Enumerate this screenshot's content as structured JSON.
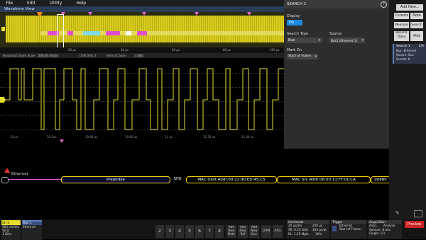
{
  "menu": {
    "file": "File",
    "edit": "Edit",
    "utility": "Utility",
    "help": "Help"
  },
  "waveform_view": {
    "title": "Waveform View"
  },
  "overview": {
    "time_labels": [
      "20 µs",
      "40 µs",
      "60 µs",
      "80 µs",
      "100 µs"
    ],
    "bus_segments": [
      {
        "color": "#e24ed0"
      },
      {
        "color": "#e24ed0"
      },
      {
        "color": "#7fd9e6"
      },
      {
        "color": "#e24ed0"
      },
      {
        "color": "#ffffff"
      },
      {
        "color": "#e24ed0"
      }
    ]
  },
  "zoom_bar": {
    "horizontal_zoom_label": "Horizontal Zoom Scale",
    "horizontal_zoom_value": "200.00 ns/div",
    "horizontal_pos": "[190.00s] 4",
    "vertical_zoom_label": "Vertical Zoom",
    "vertical_zoom_value": "1.00x"
  },
  "main_time_ticks": [
    "10 µs",
    "10.2µs",
    "10.40 µs",
    "10.60 µs",
    "11 µs",
    "11.20 µs",
    "11.40 µs"
  ],
  "search_panel": {
    "title": "SEARCH 1",
    "display_label": "Display",
    "display_toggle": "On",
    "search_type_label": "Search Type",
    "search_type_value": "Bus",
    "source_label": "Source",
    "source_value": "Bus1 (Ethernet 1)",
    "mark_on_label": "Mark On",
    "mark_on_value": "Start of Frame"
  },
  "sidebar": {
    "add_new": "Add New...",
    "cursors": "Cursors",
    "note": "Note",
    "measure": "Measure",
    "search": "Search",
    "results_table": "Results Table",
    "plot": "Plot",
    "search_badge_title": "Search 1",
    "search_badge_count": "2/4",
    "search_badge_bus": "Bus: Ethernet",
    "search_badge_search": "Search: Bus",
    "search_badge_events": "Events: 6"
  },
  "bus": {
    "name": "Ethernet",
    "preamble": "Preamble",
    "sfd": "SFD",
    "mac_dest": "MAC Dest Addr:00:22:90:ED:45:C5",
    "mac_src": "MAC Src Addr:08:00:11:FF:01:CA",
    "tail": "0088h"
  },
  "bottom": {
    "ch1_label": "Ch 1",
    "ch1_scale": "500 mV/div",
    "ch1_term": "50 Ω",
    "ch1_bw": "1 GHz",
    "bus1_label": "Bus 1",
    "bus1_type": "Ethernet",
    "channel_buttons": [
      "2",
      "3",
      "4",
      "5",
      "6",
      "7",
      "8"
    ],
    "add_math": "Add New Math",
    "add_ref": "Add New Ref",
    "add_bus": "Add New Bus",
    "dvm": "DVM",
    "afg": "AFG",
    "horizontal_title": "Horizontal",
    "horiz_scale": "20 µs/div",
    "horiz_range": "200 µs",
    "horiz_sr": "SR: 6.25 GS/s",
    "horiz_pts": "160 ps/pt",
    "horiz_rl": "RL: 1.25 Mpts",
    "horiz_pct": "10%",
    "trigger_title": "Trigger",
    "trigger_bus": "Ethernet",
    "trigger_mode": "Start of Frame",
    "acq_title": "Acquisition",
    "acq_mode": "Auto,",
    "acq_analyze": "Analyze",
    "acq_sample": "Sample: 8 bits",
    "acq_single": "Single: 1/1",
    "preview": "Preview"
  },
  "colors": {
    "ch1": "#e6dc2a",
    "bus": "#ffd700",
    "accent": "#1c8be0",
    "preview": "#cc2222"
  }
}
